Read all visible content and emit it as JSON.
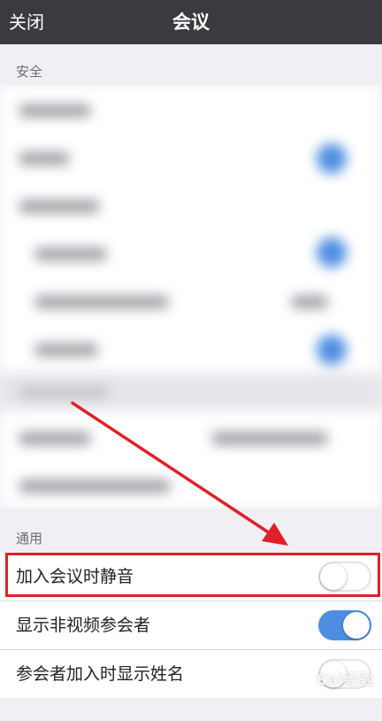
{
  "nav": {
    "close_label": "关闭",
    "title": "会议"
  },
  "sections": {
    "security_header": "安全",
    "general_header": "通用"
  },
  "general_settings": [
    {
      "label": "加入会议时静音",
      "enabled": false
    },
    {
      "label": "显示非视频参会者",
      "enabled": true
    },
    {
      "label": "参会者加入时显示姓名",
      "enabled": false
    }
  ],
  "colors": {
    "nav_bg": "#3a3a3f",
    "toggle_on": "#4d8ee0",
    "highlight": "#e0202a",
    "page_bg": "#efeff4"
  },
  "watermark": "Bai经验"
}
